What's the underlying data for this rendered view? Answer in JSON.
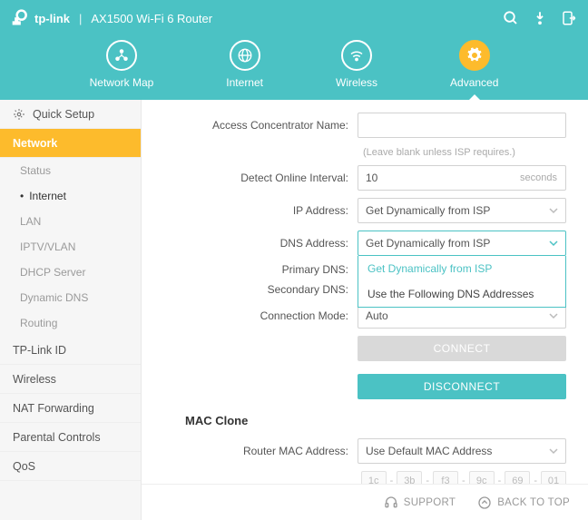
{
  "brand": "tp-link",
  "product": "AX1500 Wi-Fi 6 Router",
  "nav": {
    "items": [
      {
        "label": "Network Map"
      },
      {
        "label": "Internet"
      },
      {
        "label": "Wireless"
      },
      {
        "label": "Advanced"
      }
    ],
    "active": 3
  },
  "sidebar": {
    "quick_setup": "Quick Setup",
    "sections": [
      {
        "label": "Network",
        "active": true,
        "subs": [
          {
            "label": "Status"
          },
          {
            "label": "Internet",
            "active": true
          },
          {
            "label": "LAN"
          },
          {
            "label": "IPTV/VLAN"
          },
          {
            "label": "DHCP Server"
          },
          {
            "label": "Dynamic DNS"
          },
          {
            "label": "Routing"
          }
        ]
      },
      {
        "label": "TP-Link ID"
      },
      {
        "label": "Wireless"
      },
      {
        "label": "NAT Forwarding"
      },
      {
        "label": "Parental Controls"
      },
      {
        "label": "QoS"
      }
    ]
  },
  "form": {
    "acn_label": "Access Concentrator Name:",
    "acn_value": "",
    "acn_hint": "(Leave blank unless ISP requires.)",
    "detect_label": "Detect Online Interval:",
    "detect_value": "10",
    "detect_unit": "seconds",
    "ip_label": "IP Address:",
    "ip_value": "Get Dynamically from ISP",
    "dns_label": "DNS Address:",
    "dns_value": "Get Dynamically from ISP",
    "dns_options": [
      "Get Dynamically from ISP",
      "Use the Following DNS Addresses"
    ],
    "pri_dns_label": "Primary DNS:",
    "pri_dns_value": "",
    "sec_dns_label": "Secondary DNS:",
    "sec_dns_value": "",
    "conn_label": "Connection Mode:",
    "conn_value": "Auto",
    "connect_btn": "CONNECT",
    "disconnect_btn": "DISCONNECT",
    "mac_section": "MAC Clone",
    "router_mac_label": "Router MAC Address:",
    "router_mac_value": "Use Default MAC Address",
    "mac_segments": [
      "1c",
      "3b",
      "f3",
      "9c",
      "69",
      "01"
    ]
  },
  "footer": {
    "support": "SUPPORT",
    "back": "BACK TO TOP"
  }
}
